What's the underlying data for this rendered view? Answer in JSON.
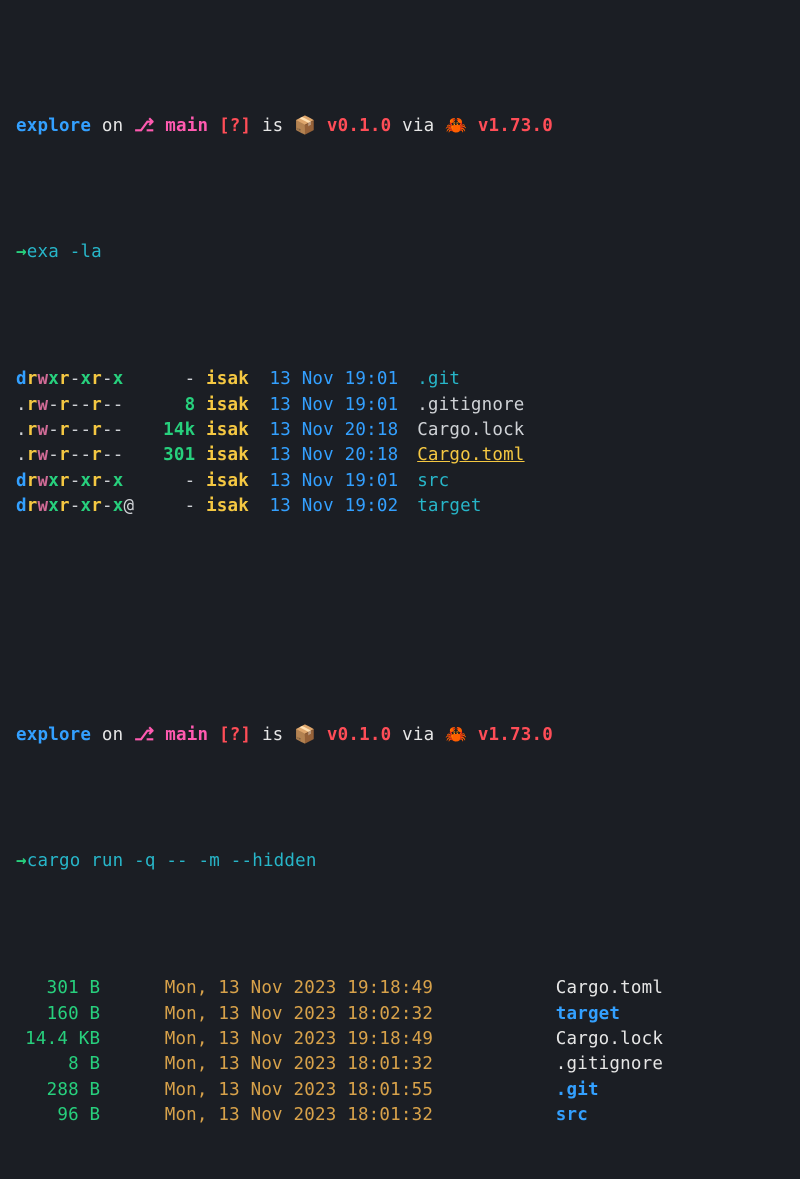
{
  "prompt": {
    "dir": "explore",
    "on": "on",
    "branch_icon": "⎇",
    "branch": "main",
    "status": "[?]",
    "is": "is",
    "pkg_icon": "📦",
    "pkg_ver": "v0.1.0",
    "via": "via",
    "lang_icon": "🦀",
    "lang_ver": "v1.73.0",
    "arrow": "→"
  },
  "cmd1": "exa -la",
  "exa": [
    {
      "perms": "drwxr-xr-x",
      "size": "-",
      "owner": "isak",
      "date": "13 Nov 19:01",
      "name": ".git",
      "name_class": "c-cyan"
    },
    {
      "perms": ".rw-r--r--",
      "size": "8",
      "owner": "isak",
      "date": "13 Nov 19:01",
      "name": ".gitignore",
      "name_class": "c-offw"
    },
    {
      "perms": ".rw-r--r--",
      "size": "14k",
      "owner": "isak",
      "date": "13 Nov 20:18",
      "name": "Cargo.lock",
      "name_class": "c-offw"
    },
    {
      "perms": ".rw-r--r--",
      "size": "301",
      "owner": "isak",
      "date": "13 Nov 20:18",
      "name": "Cargo.toml",
      "name_class": "c-yellow yul"
    },
    {
      "perms": "drwxr-xr-x",
      "size": "-",
      "owner": "isak",
      "date": "13 Nov 19:01",
      "name": "src",
      "name_class": "c-cyan"
    },
    {
      "perms": "drwxr-xr-x@",
      "size": "-",
      "owner": "isak",
      "date": "13 Nov 19:02",
      "name": "target",
      "name_class": "c-cyan"
    }
  ],
  "cmd2": "cargo run -q -- -m --hidden",
  "cargo": [
    {
      "size": "301 B",
      "date": "Mon, 13 Nov 2023 19:18:49",
      "name": "Cargo.toml",
      "name_class": "c-white"
    },
    {
      "size": "160 B",
      "date": "Mon, 13 Nov 2023 18:02:32",
      "name": "target",
      "name_class": "c-blue bold"
    },
    {
      "size": "14.4 KB",
      "date": "Mon, 13 Nov 2023 19:18:49",
      "name": "Cargo.lock",
      "name_class": "c-white"
    },
    {
      "size": "8 B",
      "date": "Mon, 13 Nov 2023 18:01:32",
      "name": ".gitignore",
      "name_class": "c-white"
    },
    {
      "size": "288 B",
      "date": "Mon, 13 Nov 2023 18:01:55",
      "name": ".git",
      "name_class": "c-blue bold"
    },
    {
      "size": "96 B",
      "date": "Mon, 13 Nov 2023 18:01:32",
      "name": "src",
      "name_class": "c-blue bold"
    }
  ]
}
